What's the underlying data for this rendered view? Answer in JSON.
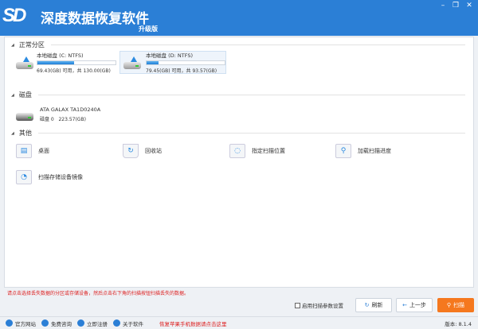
{
  "app": {
    "logo": "SD",
    "title": "深度数据恢复软件",
    "edition": "升级版"
  },
  "window": {
    "minimize": "–",
    "restore": "❐",
    "close": "✕"
  },
  "sections": {
    "partitions": "正常分区",
    "disks": "磁盘",
    "others": "其他"
  },
  "partitions": [
    {
      "name": "本地磁盘 (C: NTFS)",
      "capacity": "69.43(GB) 可用，共 130.00(GB)",
      "used_fraction": 0.47,
      "selected": false
    },
    {
      "name": "本地磁盘 (D: NTFS)",
      "capacity": "79.45(GB) 可用，共 93.57(GB)",
      "used_fraction": 0.15,
      "selected": true
    }
  ],
  "disks": [
    {
      "model": "ATA GALAX TA1D0240A",
      "index": "磁盘 0",
      "size": "223.57(GB)"
    }
  ],
  "others": [
    {
      "label": "桌面",
      "icon": "desktop-icon"
    },
    {
      "label": "回收站",
      "icon": "recycle-bin-icon"
    },
    {
      "label": "指定扫描位置",
      "icon": "scan-location-icon"
    },
    {
      "label": "加载扫描进度",
      "icon": "load-progress-icon"
    },
    {
      "label": "扫描存储设备镜像",
      "icon": "disk-image-icon"
    }
  ],
  "status": "请点击选择丢失数据的分区或存储设备，然后点击右下角的扫描按钮扫描丢失的数据。",
  "actions": {
    "enable_params": "启用扫描参数设置",
    "refresh": "刷新",
    "back": "上一步",
    "scan": "扫描"
  },
  "footer": {
    "links": [
      "官方网站",
      "免费咨询",
      "立即注册",
      "关于软件"
    ],
    "promo": "恢复苹果手机数据请点击这里",
    "version": "版本: 8.1.4"
  },
  "colors": {
    "brand": "#2b7fd6",
    "accent": "#f5781e",
    "status": "#dd2222"
  }
}
